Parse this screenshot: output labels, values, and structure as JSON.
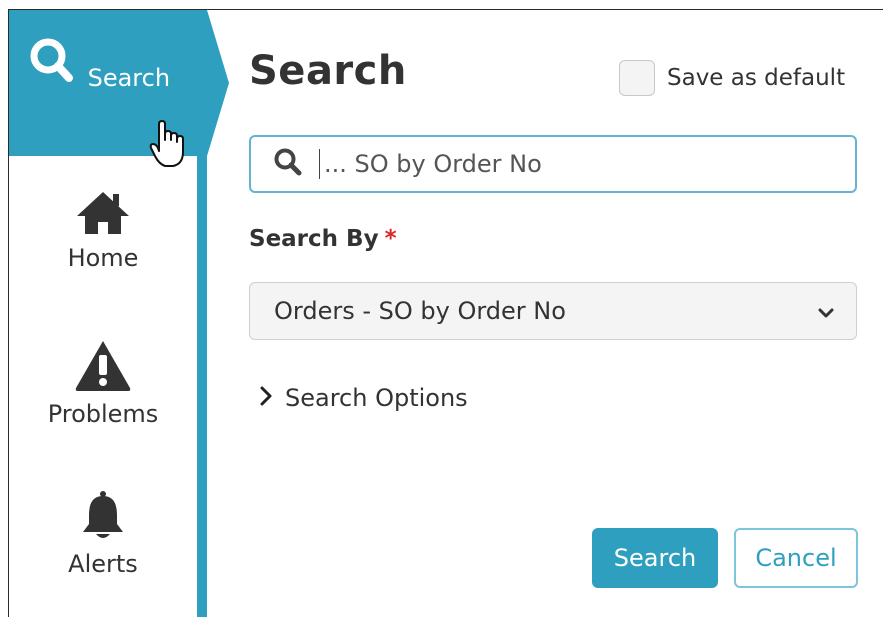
{
  "sidebar": {
    "items": [
      {
        "label": "Search",
        "icon": "search-icon",
        "active": true
      },
      {
        "label": "Home",
        "icon": "home-icon",
        "active": false
      },
      {
        "label": "Problems",
        "icon": "warning-icon",
        "active": false
      },
      {
        "label": "Alerts",
        "icon": "bell-icon",
        "active": false
      }
    ],
    "accent": "#2f9fbf"
  },
  "main": {
    "title": "Search",
    "save_default_label": "Save as default",
    "save_default_checked": false,
    "search_placeholder": "... SO by Order No",
    "search_by_label": "Search By",
    "required_marker": "*",
    "search_by_value": "Orders - SO by Order No",
    "search_options_label": "Search Options",
    "search_button": "Search",
    "cancel_button": "Cancel"
  },
  "colors": {
    "accent": "#2f9fbf",
    "required": "#d9262c",
    "text": "#333333"
  }
}
